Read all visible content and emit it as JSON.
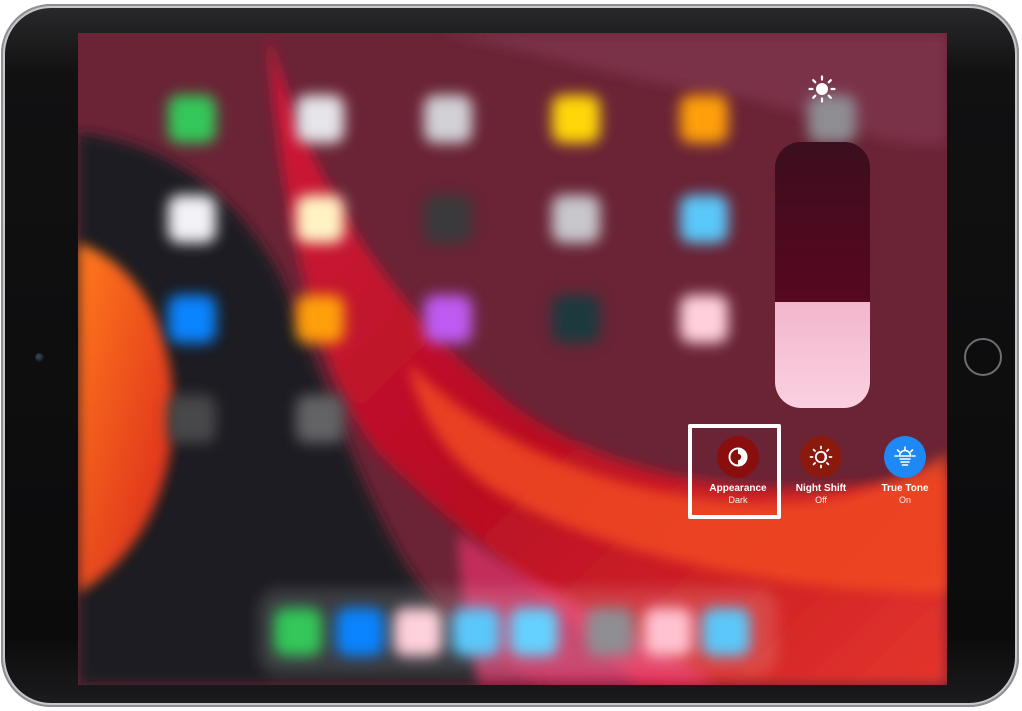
{
  "device": {
    "name": "iPad"
  },
  "control_center": {
    "brightness": {
      "level": 0.4,
      "icon": "sun-icon"
    },
    "controls": [
      {
        "label": "Appearance",
        "value": "Dark",
        "icon": "appearance-icon",
        "color": "#8b0e0e",
        "highlighted": true
      },
      {
        "label": "Night Shift",
        "value": "Off",
        "icon": "night-shift-icon",
        "color": "#8b1a0e"
      },
      {
        "label": "True Tone",
        "value": "On",
        "icon": "true-tone-icon",
        "color": "#1e88f5"
      }
    ]
  },
  "colors": {
    "accent_blue": "#1e88f5",
    "highlight_border": "#ffffff",
    "wallpaper_red": "#c8122a",
    "wallpaper_orange": "#ff6a1a"
  }
}
